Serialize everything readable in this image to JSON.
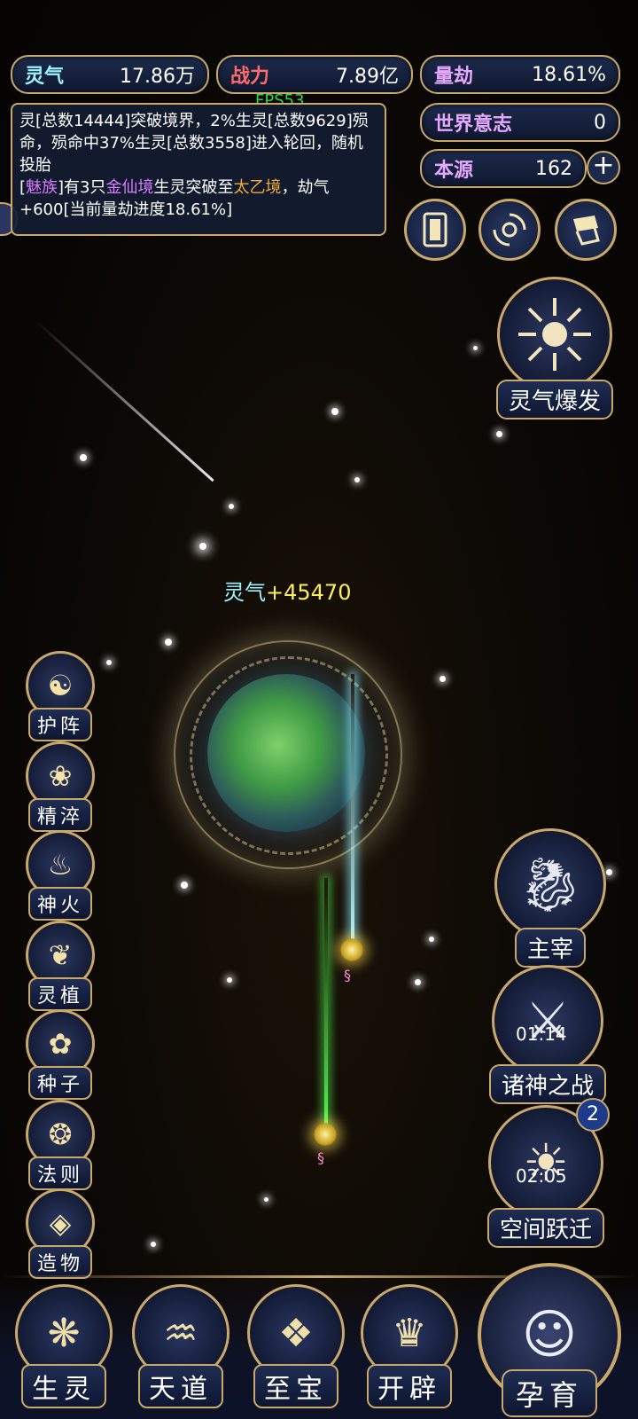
{
  "stats": {
    "lingqi": {
      "label": "灵气",
      "value": "17.86万"
    },
    "zhanli": {
      "label": "战力",
      "value": "7.89亿"
    },
    "liangjie": {
      "label": "量劫",
      "value": "18.61%"
    },
    "shijie": {
      "label": "世界意志",
      "value": "0"
    },
    "benyuan": {
      "label": "本源",
      "value": "162"
    }
  },
  "fps": "FPS53",
  "log": {
    "line1": "灵[总数14444]突破境界，2%生灵[总数9629]殒命，殒命中37%生灵[总数3558]进入轮回，随机投胎",
    "line2_a": "[",
    "line2_race": "魅族",
    "line2_b": "]有3只",
    "line2_realm1": "金仙境",
    "line2_c": "生灵突破至",
    "line2_realm2": "太乙境",
    "line2_d": "，劫气+600[当前量劫进度18.61%]"
  },
  "right_actions": {
    "burst": "灵气爆发",
    "master": "主宰",
    "war": "诸神之战",
    "war_timer": "01:14",
    "warp": "空间跃迁",
    "warp_timer": "02:05",
    "warp_badge": "2"
  },
  "gain": {
    "label": "灵气",
    "value": "+45470"
  },
  "left_menu": [
    "护阵",
    "精淬",
    "神火",
    "灵植",
    "种子",
    "法则",
    "造物"
  ],
  "bottom_nav": [
    "生灵",
    "天道",
    "至宝",
    "开辟"
  ],
  "nurture": "孕育",
  "icons": {
    "cards": "cards-icon",
    "vortex": "vortex-icon",
    "flag": "flag-icon",
    "plus": "plus-icon"
  }
}
